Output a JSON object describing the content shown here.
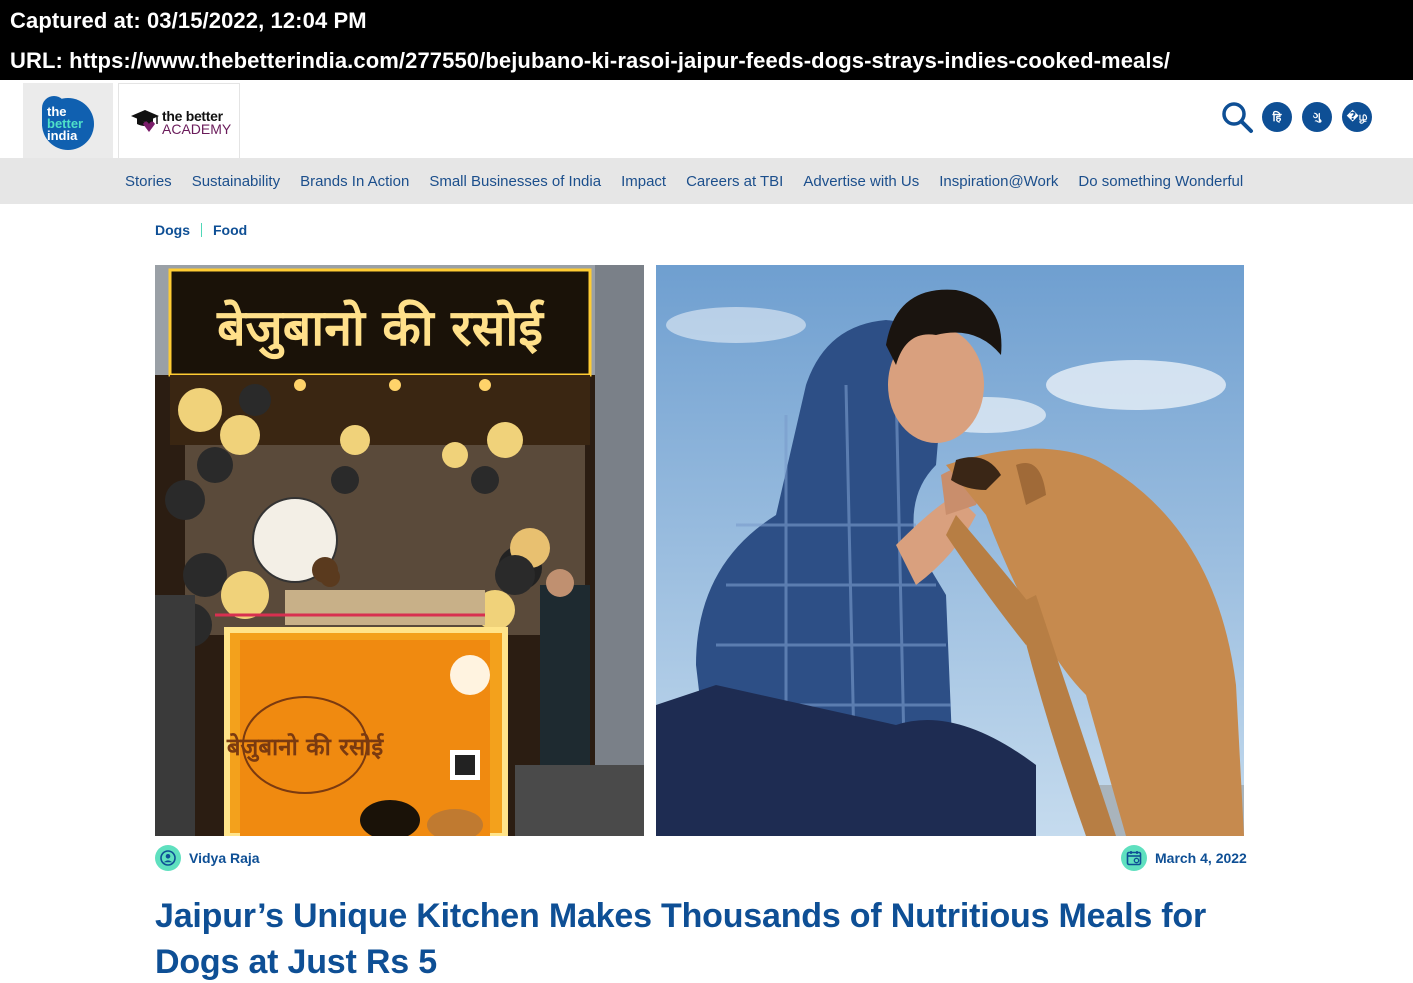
{
  "capture": {
    "captured_at": "Captured at: 03/15/2022, 12:04 PM",
    "url": "URL: https://www.thebetterindia.com/277550/bejubano-ki-rasoi-jaipur-feeds-dogs-strays-indies-cooked-meals/"
  },
  "header": {
    "logo_primary": [
      "the",
      "better",
      "india"
    ],
    "logo_academy": [
      "the better",
      "ACADEMY"
    ],
    "language_buttons": [
      "हि",
      "ગુ",
      "�ழ"
    ]
  },
  "nav": {
    "items": [
      "Stories",
      "Sustainability",
      "Brands In Action",
      "Small Businesses of India",
      "Impact",
      "Careers at TBI",
      "Advertise with Us",
      "Inspiration@Work",
      "Do something Wonderful"
    ]
  },
  "breadcrumb": [
    "Dogs",
    "Food"
  ],
  "images": {
    "left_sign_text": "बेजुबानो की रसोई",
    "left_counter_text": "बेजुबानो की रसोई"
  },
  "article": {
    "author": "Vidya Raja",
    "date": "March 4, 2022",
    "headline_line1": "Jaipur’s Unique Kitchen Makes Thousands of Nutritious Meals for",
    "headline_line2": "Dogs at Just Rs 5"
  },
  "colors": {
    "brand_blue": "#0e4f95",
    "accent_teal": "#5fe0bf",
    "nav_bg": "#e6e6e6"
  }
}
